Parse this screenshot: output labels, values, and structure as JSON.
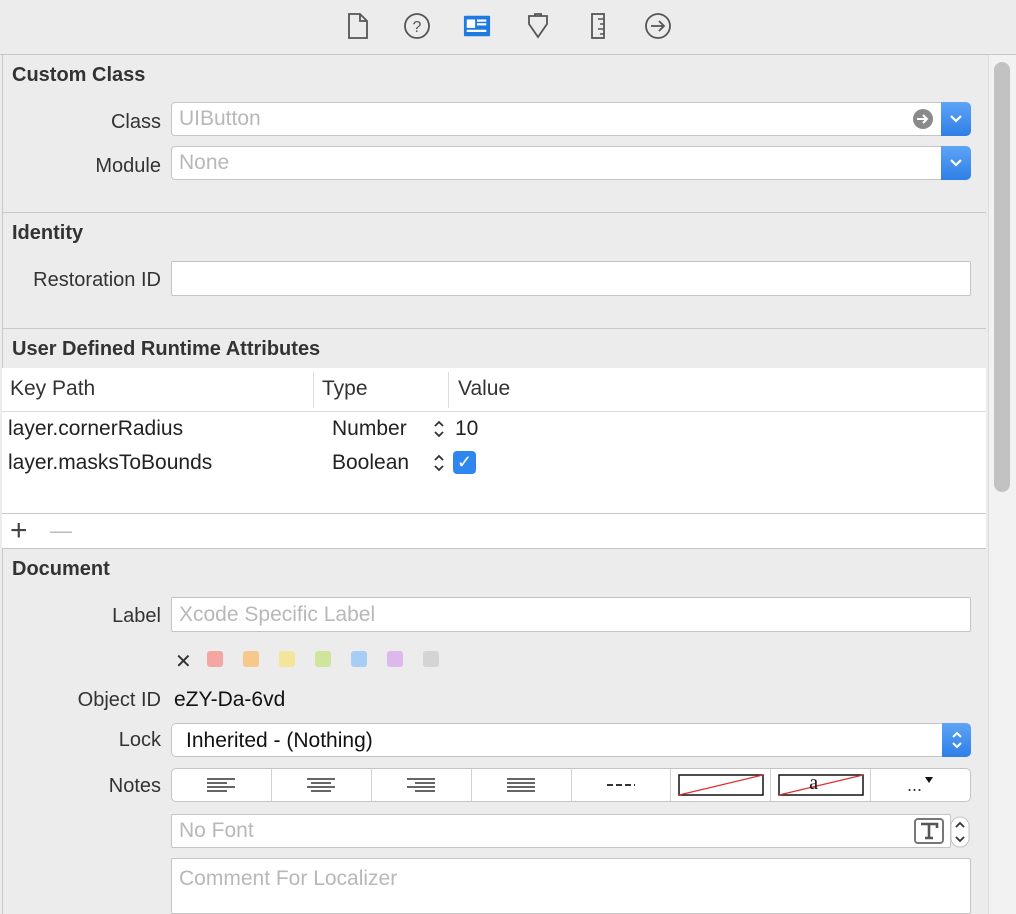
{
  "toolbar": {
    "icons": [
      "file-icon",
      "help-icon",
      "identity-icon",
      "attributes-icon",
      "size-icon",
      "connections-icon"
    ]
  },
  "custom_class": {
    "title": "Custom Class",
    "class_label": "Class",
    "class_placeholder": "UIButton",
    "module_label": "Module",
    "module_placeholder": "None"
  },
  "identity": {
    "title": "Identity",
    "restoration_label": "Restoration ID",
    "restoration_value": ""
  },
  "runtime": {
    "title": "User Defined Runtime Attributes",
    "columns": [
      "Key Path",
      "Type",
      "Value"
    ],
    "rows": [
      {
        "key_path": "layer.cornerRadius",
        "type": "Number",
        "value": "10"
      },
      {
        "key_path": "layer.masksToBounds",
        "type": "Boolean",
        "value": "✓"
      }
    ],
    "add_symbol": "+",
    "remove_symbol": "—"
  },
  "document": {
    "title": "Document",
    "label_label": "Label",
    "label_placeholder": "Xcode Specific Label",
    "clear_symbol": "✕",
    "swatch_colors": [
      "#f4a6a3",
      "#f6c88c",
      "#f4e59a",
      "#cfe59b",
      "#a8cdf5",
      "#dcb8ec",
      "#d4d4d4"
    ],
    "object_id_label": "Object ID",
    "object_id_value": "eZY-Da-6vd",
    "lock_label": "Lock",
    "lock_value": "Inherited - (Nothing)",
    "notes_label": "Notes",
    "notes_more": "...",
    "notes_sample": "a",
    "font_placeholder": "No Font",
    "comment_placeholder": "Comment For Localizer"
  },
  "colors": {
    "accent": "#2f7fe8",
    "selected_icon": "#1f7ae0"
  }
}
